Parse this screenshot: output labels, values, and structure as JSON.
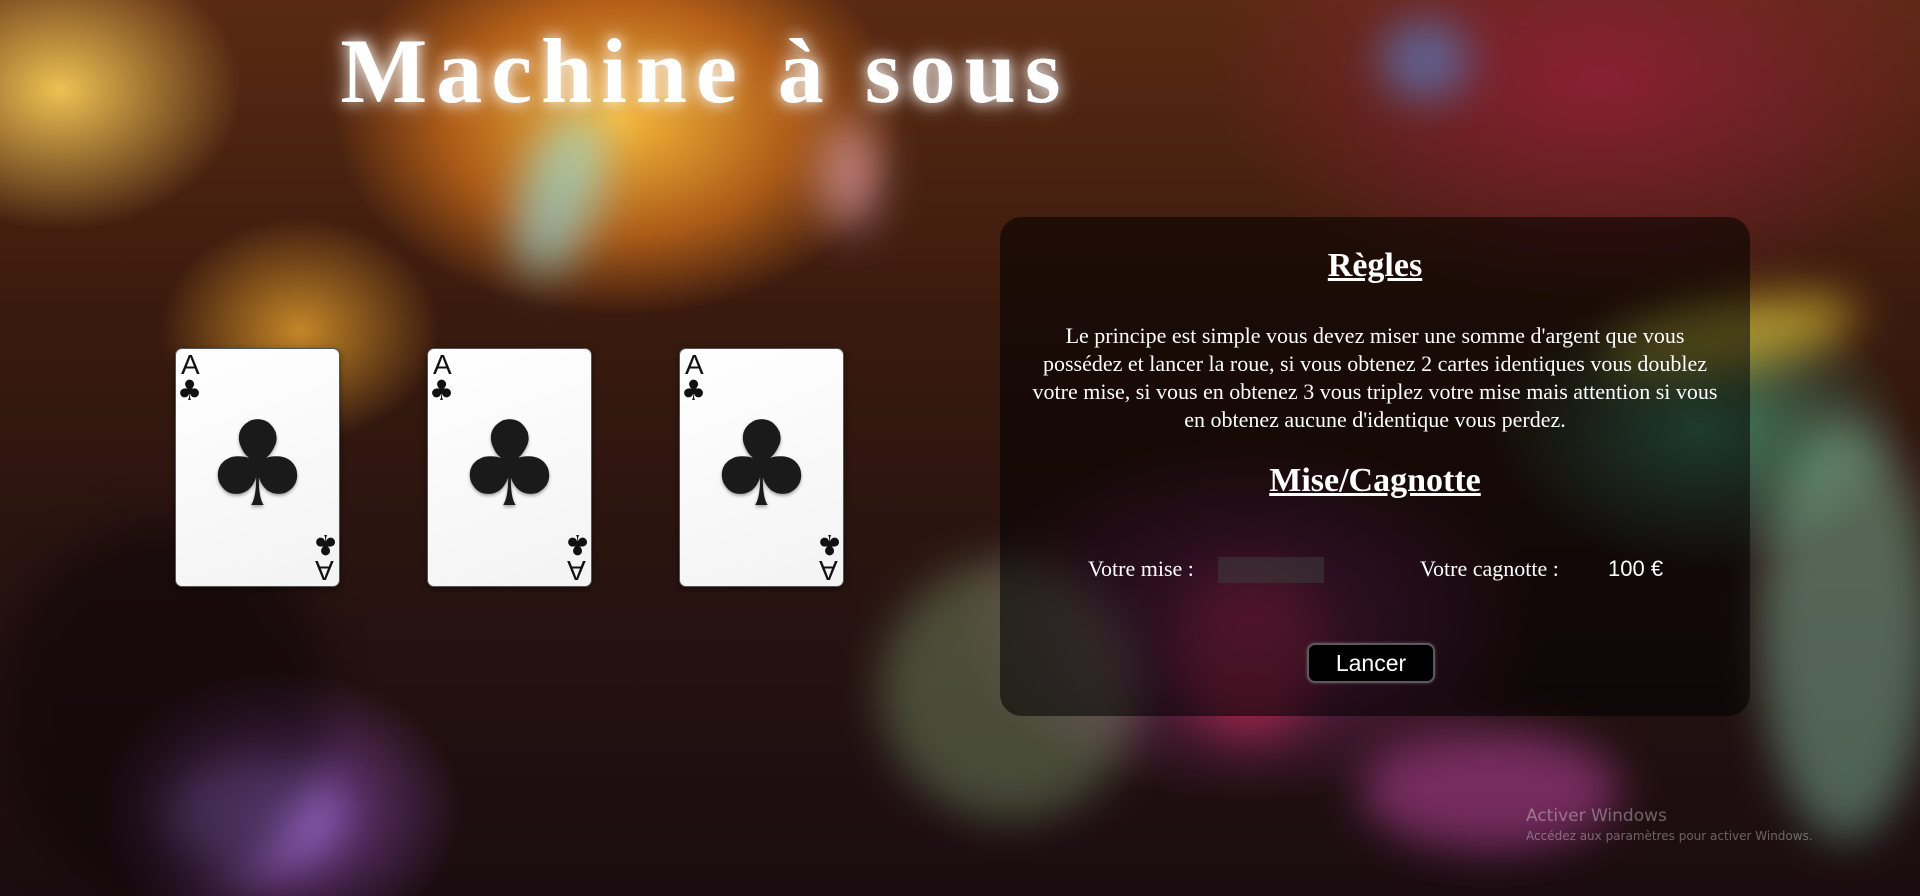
{
  "page": {
    "title": "Machine à sous"
  },
  "reels": [
    {
      "rank": "A",
      "suit": "♣",
      "suit_name": "clubs"
    },
    {
      "rank": "A",
      "suit": "♣",
      "suit_name": "clubs"
    },
    {
      "rank": "A",
      "suit": "♣",
      "suit_name": "clubs"
    }
  ],
  "rules": {
    "title": "Règles",
    "text": "Le principe est simple vous devez miser une somme d'argent que vous possédez et lancer la roue, si vous obtenez 2 cartes identiques vous doublez votre mise, si vous en obtenez 3 vous triplez votre mise mais attention si vous en obtenez aucune d'identique vous perdez."
  },
  "betting": {
    "title": "Mise/Cagnotte",
    "bet_label": "Votre mise :",
    "bet_value": "",
    "jackpot_label": "Votre cagnotte :",
    "jackpot_value": "100 €",
    "spin_label": "Lancer"
  },
  "watermark": {
    "title": "Activer Windows",
    "subtitle": "Accédez aux paramètres pour activer Windows."
  },
  "colors": {
    "panel_bg": "rgba(0,0,0,0.55)",
    "text": "#ffffff",
    "button_bg": "#000000"
  }
}
